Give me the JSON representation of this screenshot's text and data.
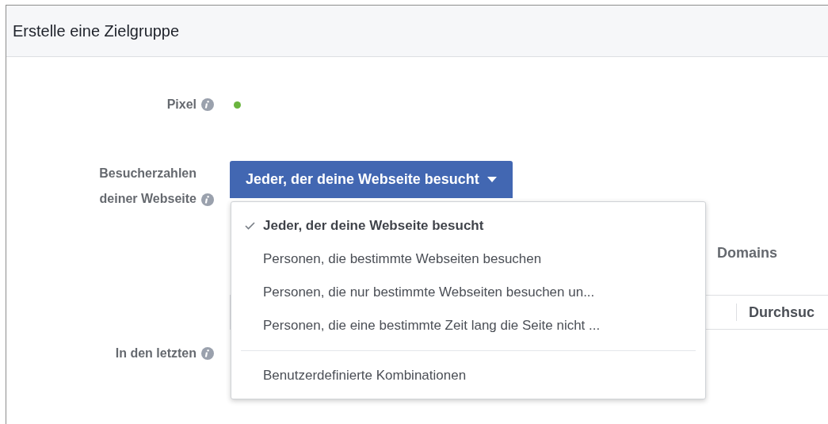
{
  "header": {
    "title": "Erstelle eine Zielgruppe"
  },
  "form": {
    "pixel": {
      "label": "Pixel",
      "active": true
    },
    "visitors": {
      "label": "Besucherzahlen deiner Webseite",
      "dropdown": {
        "value": "Jeder, der deine Webseite besucht",
        "expanded": true,
        "items": [
          {
            "kind": "option",
            "label": "Jeder, der deine Webseite besucht",
            "selected": true
          },
          {
            "kind": "option",
            "label": "Personen, die bestimmte Webseiten besuchen",
            "selected": false
          },
          {
            "kind": "option",
            "label": "Personen, die nur bestimmte Webseiten besuchen un...",
            "selected": false
          },
          {
            "kind": "option",
            "label": "Personen, die eine bestimmte Zeit lang die Seite nicht ...",
            "selected": false
          },
          {
            "kind": "divider"
          },
          {
            "kind": "option",
            "label": "Benutzerdefinierte Kombinationen",
            "selected": false
          }
        ]
      }
    },
    "domains_text": "Domains",
    "url_field": {
      "button": "Durchsuc"
    },
    "period": {
      "label": "In den letzten"
    }
  }
}
